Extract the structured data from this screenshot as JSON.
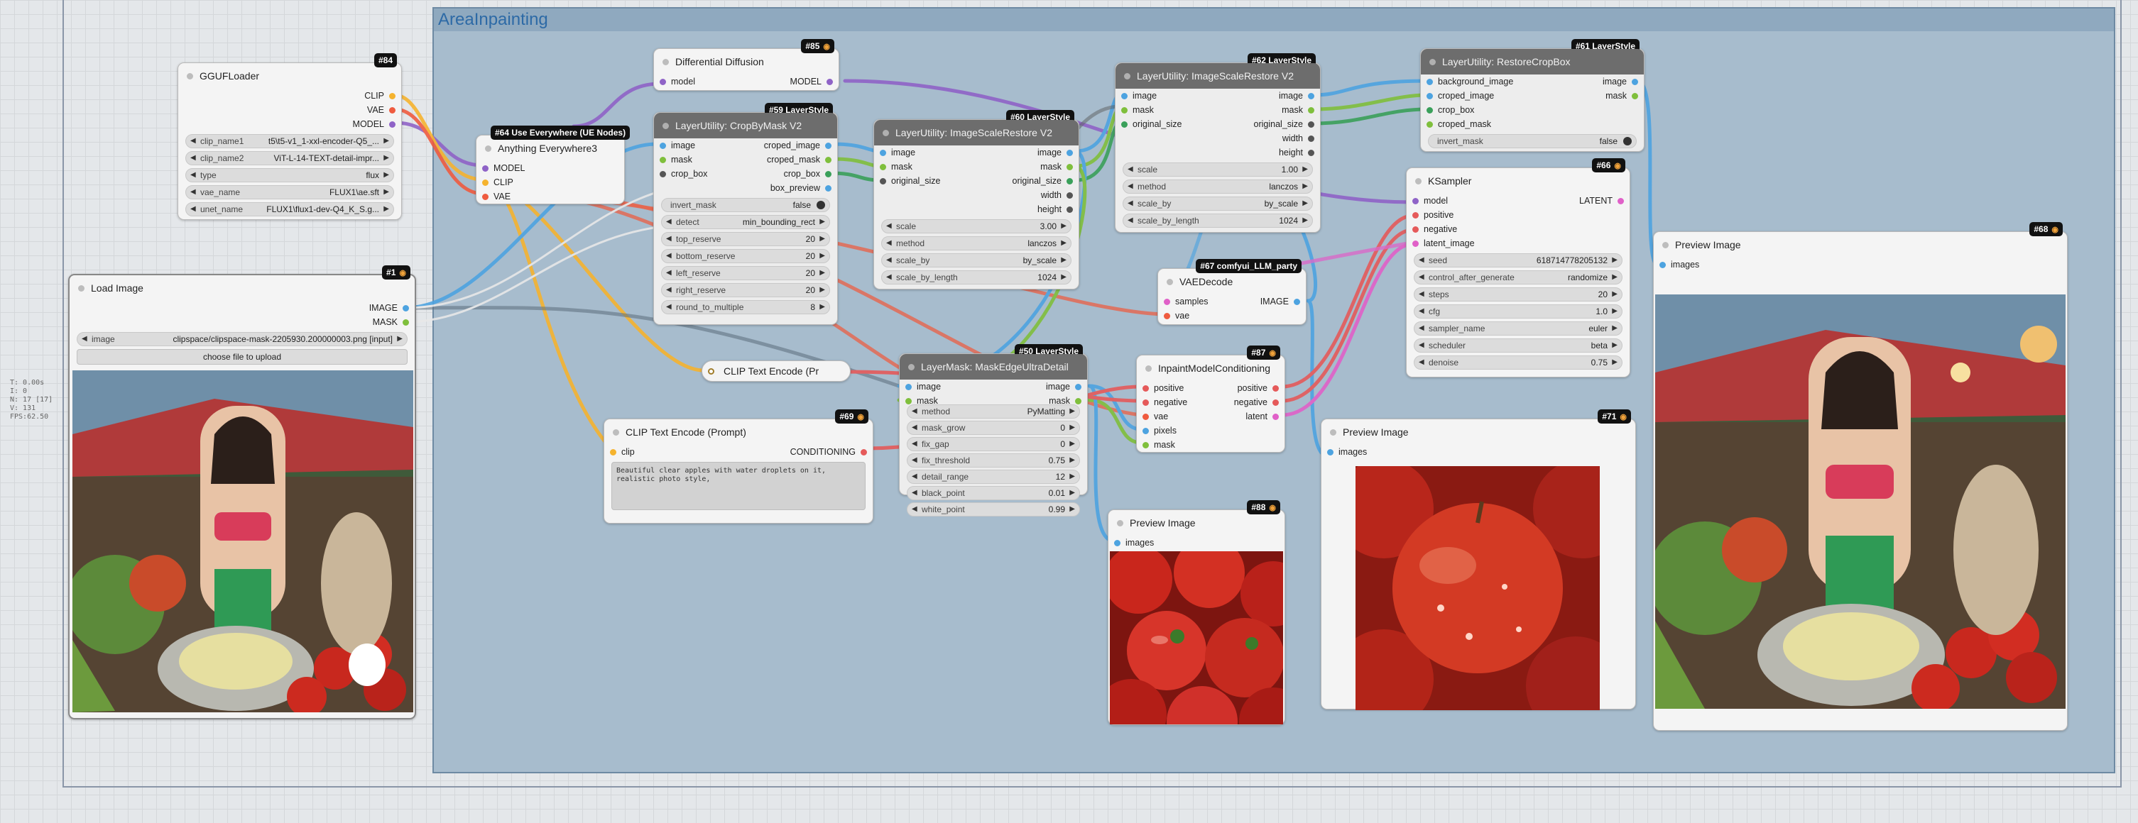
{
  "stats": "T: 0.00s\nI: 0\nN: 17 [17]\nV: 131\nFPS:62.50",
  "group": {
    "title": "AreaInpainting"
  },
  "gguf": {
    "badge": "#84",
    "title": "GGUFLoader",
    "outputs": [
      "CLIP",
      "VAE",
      "MODEL"
    ],
    "widgets": [
      {
        "label": "clip_name1",
        "value": "t5\\t5-v1_1-xxl-encoder-Q5_..."
      },
      {
        "label": "clip_name2",
        "value": "ViT-L-14-TEXT-detail-impr..."
      },
      {
        "label": "type",
        "value": "flux"
      },
      {
        "label": "vae_name",
        "value": "FLUX1\\ae.sft"
      },
      {
        "label": "unet_name",
        "value": "FLUX1\\flux1-dev-Q4_K_S.g..."
      }
    ]
  },
  "load": {
    "badge": "#1",
    "title": "Load Image",
    "outputs": [
      "IMAGE",
      "MASK"
    ],
    "image_label": "image",
    "image_value": "clipspace/clipspace-mask-2205930.200000003.png [input]",
    "upload": "choose file to upload"
  },
  "ae": {
    "badge": "#64 Use Everywhere (UE Nodes)",
    "title": "Anything Everywhere3",
    "inputs": [
      "MODEL",
      "CLIP",
      "VAE"
    ]
  },
  "dd": {
    "badge": "#85",
    "title": "Differential Diffusion",
    "input": "model",
    "output": "MODEL"
  },
  "crop": {
    "badge": "#59 LayerStyle",
    "title": "LayerUtility: CropByMask V2",
    "inputs": [
      "image",
      "mask",
      "crop_box"
    ],
    "outputs": [
      "croped_image",
      "croped_mask",
      "crop_box",
      "box_preview"
    ],
    "toggle": {
      "label": "invert_mask",
      "value": "false"
    },
    "widgets": [
      {
        "label": "detect",
        "value": "min_bounding_rect"
      },
      {
        "label": "top_reserve",
        "value": "20"
      },
      {
        "label": "bottom_reserve",
        "value": "20"
      },
      {
        "label": "left_reserve",
        "value": "20"
      },
      {
        "label": "right_reserve",
        "value": "20"
      },
      {
        "label": "round_to_multiple",
        "value": "8"
      }
    ]
  },
  "isr60": {
    "badge": "#60 LayerStyle",
    "title": "LayerUtility: ImageScaleRestore V2",
    "inputs": [
      "image",
      "mask",
      "original_size"
    ],
    "outputs": [
      "image",
      "mask",
      "original_size",
      "width",
      "height"
    ],
    "widgets": [
      {
        "label": "scale",
        "value": "3.00"
      },
      {
        "label": "method",
        "value": "lanczos"
      },
      {
        "label": "scale_by",
        "value": "by_scale"
      },
      {
        "label": "scale_by_length",
        "value": "1024"
      }
    ]
  },
  "isr62": {
    "badge": "#62 LayerStyle",
    "title": "LayerUtility: ImageScaleRestore V2",
    "inputs": [
      "image",
      "mask",
      "original_size"
    ],
    "outputs": [
      "image",
      "mask",
      "original_size",
      "width",
      "height"
    ],
    "widgets": [
      {
        "label": "scale",
        "value": "1.00"
      },
      {
        "label": "method",
        "value": "lanczos"
      },
      {
        "label": "scale_by",
        "value": "by_scale"
      },
      {
        "label": "scale_by_length",
        "value": "1024"
      }
    ]
  },
  "rcb": {
    "badge": "#61 LayerStyle",
    "title": "LayerUtility: RestoreCropBox",
    "inputs": [
      "background_image",
      "croped_image",
      "crop_box",
      "croped_mask"
    ],
    "outputs": [
      "image",
      "mask"
    ],
    "toggle": {
      "label": "invert_mask",
      "value": "false"
    }
  },
  "ks": {
    "badge": "#66",
    "title": "KSampler",
    "inputs": [
      "model",
      "positive",
      "negative",
      "latent_image"
    ],
    "output": "LATENT",
    "widgets": [
      {
        "label": "seed",
        "value": "618714778205132"
      },
      {
        "label": "control_after_generate",
        "value": "randomize"
      },
      {
        "label": "steps",
        "value": "20"
      },
      {
        "label": "cfg",
        "value": "1.0"
      },
      {
        "label": "sampler_name",
        "value": "euler"
      },
      {
        "label": "scheduler",
        "value": "beta"
      },
      {
        "label": "denoise",
        "value": "0.75"
      }
    ]
  },
  "vaed": {
    "badge": "#67 comfyui_LLM_party",
    "title": "VAEDecode",
    "inputs": [
      "samples",
      "vae"
    ],
    "output": "IMAGE"
  },
  "cte_small": {
    "title": "CLIP Text Encode (Pr"
  },
  "cte": {
    "badge": "#69",
    "title": "CLIP Text Encode (Prompt)",
    "input": "clip",
    "output": "CONDITIONING",
    "text": "Beautiful clear apples with water droplets on it, realistic photo style,"
  },
  "lm": {
    "badge": "#50 LayerStyle",
    "title": "LayerMask: MaskEdgeUltraDetail",
    "inputs": [
      "image",
      "mask"
    ],
    "outputs": [
      "image",
      "mask"
    ],
    "widgets": [
      {
        "label": "method",
        "value": "PyMatting"
      },
      {
        "label": "mask_grow",
        "value": "0"
      },
      {
        "label": "fix_gap",
        "value": "0"
      },
      {
        "label": "fix_threshold",
        "value": "0.75"
      },
      {
        "label": "detail_range",
        "value": "12"
      },
      {
        "label": "black_point",
        "value": "0.01"
      },
      {
        "label": "white_point",
        "value": "0.99"
      }
    ]
  },
  "imc": {
    "badge": "#87",
    "title": "InpaintModelConditioning",
    "inputs": [
      "positive",
      "negative",
      "vae",
      "pixels",
      "mask"
    ],
    "outputs": [
      "positive",
      "negative",
      "latent"
    ]
  },
  "pv88": {
    "badge": "#88",
    "title": "Preview Image",
    "input": "images"
  },
  "pv71": {
    "badge": "#71",
    "title": "Preview Image",
    "input": "images"
  },
  "pv68": {
    "badge": "#68",
    "title": "Preview Image",
    "input": "images"
  },
  "colors": {
    "model": "#8f63c7",
    "clip": "#f5b32e",
    "vae": "#ef5b3f",
    "image": "#4da3e0",
    "mask": "#7fbf3c",
    "crop_box": "#3aa05a",
    "conditioning": "#e55a5a",
    "latent": "#e060c8",
    "group": "#a7bccd"
  }
}
